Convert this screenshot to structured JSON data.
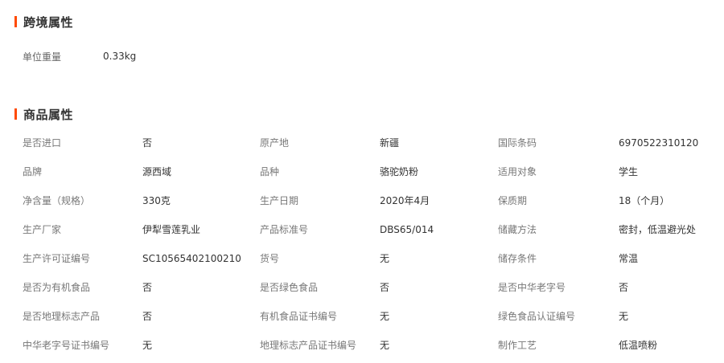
{
  "sections": {
    "cross_border": {
      "title": "跨境属性",
      "items": [
        {
          "label": "单位重量",
          "value": "0.33kg"
        }
      ]
    },
    "product": {
      "title": "商品属性",
      "rows": [
        [
          {
            "label": "是否进口",
            "value": "否"
          },
          {
            "label": "原产地",
            "value": "新疆"
          },
          {
            "label": "国际条码",
            "value": "6970522310120"
          }
        ],
        [
          {
            "label": "品牌",
            "value": "源西域"
          },
          {
            "label": "品种",
            "value": "骆驼奶粉"
          },
          {
            "label": "适用对象",
            "value": "学生"
          }
        ],
        [
          {
            "label": "净含量（规格）",
            "value": "330克"
          },
          {
            "label": "生产日期",
            "value": "2020年4月"
          },
          {
            "label": "保质期",
            "value": "18（个月）"
          }
        ],
        [
          {
            "label": "生产厂家",
            "value": "伊犁雪莲乳业"
          },
          {
            "label": "产品标准号",
            "value": "DBS65/014"
          },
          {
            "label": "储藏方法",
            "value": "密封，低温避光处"
          }
        ],
        [
          {
            "label": "生产许可证编号",
            "value": "SC10565402100210"
          },
          {
            "label": "货号",
            "value": "无"
          },
          {
            "label": "储存条件",
            "value": "常温"
          }
        ],
        [
          {
            "label": "是否为有机食品",
            "value": "否"
          },
          {
            "label": "是否绿色食品",
            "value": "否"
          },
          {
            "label": "是否中华老字号",
            "value": "否"
          }
        ],
        [
          {
            "label": "是否地理标志产品",
            "value": "否"
          },
          {
            "label": "有机食品证书编号",
            "value": "无"
          },
          {
            "label": "绿色食品认证编号",
            "value": "无"
          }
        ],
        [
          {
            "label": "中华老字号证书编号",
            "value": "无"
          },
          {
            "label": "地理标志产品证书编号",
            "value": "无"
          },
          {
            "label": "制作工艺",
            "value": "低温喷粉"
          }
        ]
      ]
    }
  },
  "colors": {
    "accent": "#ff4a00",
    "label": "#777777",
    "value": "#333333"
  }
}
